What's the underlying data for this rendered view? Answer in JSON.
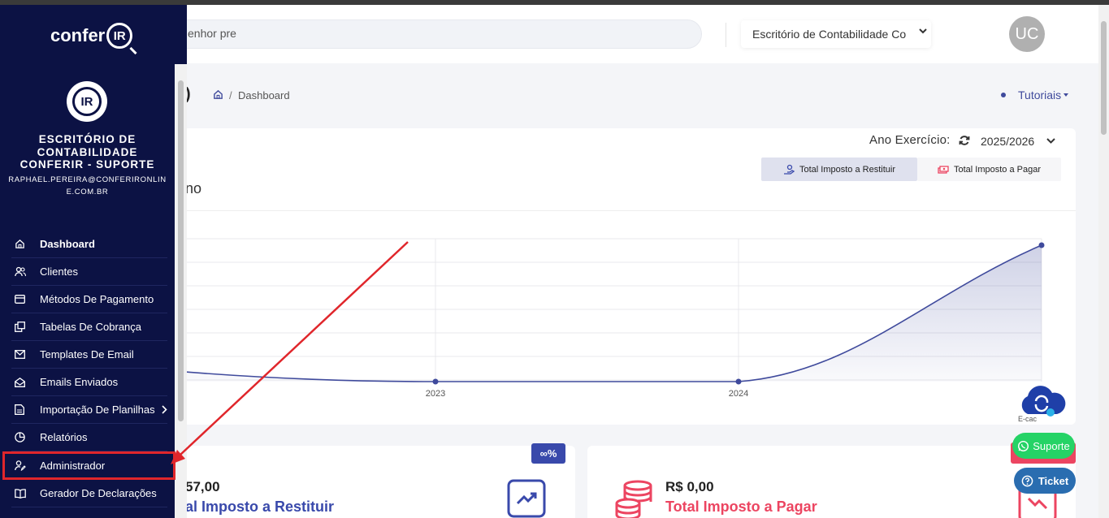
{
  "header": {
    "search_value": "enhor pre",
    "office_select": "Escritório de Contabilidade Co",
    "avatar_initials": "UC"
  },
  "breadcrumb": {
    "title_fragment": ")",
    "current": "Dashboard",
    "separator": "/"
  },
  "tutorials_label": "Tutoriais",
  "chart_card": {
    "title_fragment": "no",
    "year_label": "Ano Exercício:",
    "year_value": "2025/2026",
    "tab_restituir": "Total Imposto a Restituir",
    "tab_pagar": "Total Imposto a Pagar"
  },
  "chart_data": {
    "type": "area",
    "x": [
      "",
      "2023",
      "2024",
      ""
    ],
    "series": [
      {
        "values": [
          0.08,
          0.0,
          0.0,
          1.0
        ]
      }
    ],
    "xlabel": "",
    "ylabel": "",
    "grid": true,
    "color": "#3f4a9c"
  },
  "cards": {
    "badge": "∞%",
    "restituir_value": "57,00",
    "restituir_label": "al Imposto a Restituir",
    "pagar_value": "R$ 0,00",
    "pagar_label": "Total Imposto a Pagar"
  },
  "widgets": {
    "ecac": "E-cac",
    "suporte": "Suporte",
    "ticket": "Ticket"
  },
  "sidebar": {
    "logo_text": "confer",
    "logo_ir": "IR",
    "emblem_ir": "IR",
    "office_name": "ESCRITÓRIO DE CONTABILIDADE CONFERIR - SUPORTE",
    "email": "RAPHAEL.PEREIRA@CONFERIRONLINE.COM.BR",
    "items": [
      {
        "label": "Dashboard",
        "icon": "home-icon"
      },
      {
        "label": "Clientes",
        "icon": "users-icon"
      },
      {
        "label": "Métodos De Pagamento",
        "icon": "credit-card-icon"
      },
      {
        "label": "Tabelas De Cobrança",
        "icon": "table-icon"
      },
      {
        "label": "Templates De Email",
        "icon": "mail-icon"
      },
      {
        "label": "Emails Enviados",
        "icon": "mail-open-icon"
      },
      {
        "label": "Importação De Planilhas",
        "icon": "spreadsheet-icon"
      },
      {
        "label": "Relatórios",
        "icon": "pie-chart-icon"
      },
      {
        "label": "Administrador",
        "icon": "user-edit-icon"
      },
      {
        "label": "Gerador De Declarações",
        "icon": "book-icon"
      }
    ]
  },
  "colors": {
    "sidebar_bg": "#0c1244",
    "primary": "#3949ab",
    "danger": "#ec4561",
    "whatsapp": "#25d366",
    "highlight": "#e0262b"
  }
}
